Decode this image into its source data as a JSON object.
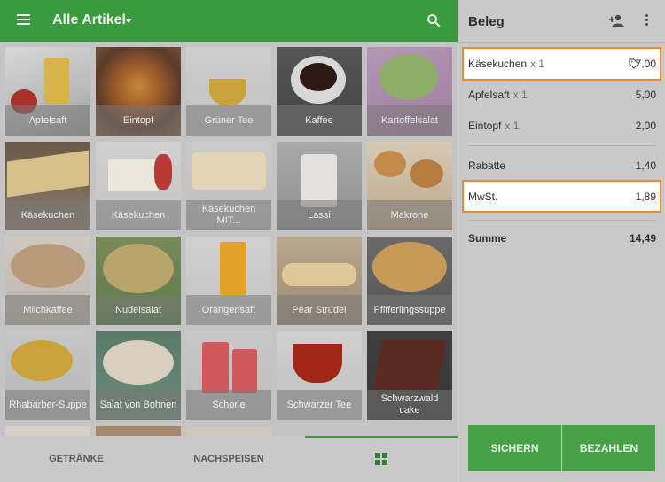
{
  "header": {
    "title": "Alle Artikel",
    "menu_icon": "menu-icon",
    "search_icon": "search-icon"
  },
  "products": [
    {
      "label": "Apfelsaft"
    },
    {
      "label": "Eintopf"
    },
    {
      "label": "Grüner Tee"
    },
    {
      "label": "Kaffee"
    },
    {
      "label": "Kartoffelsalat"
    },
    {
      "label": "Käsekuchen"
    },
    {
      "label": "Käsekuchen"
    },
    {
      "label": "Käsekuchen MIT..."
    },
    {
      "label": "Lassi"
    },
    {
      "label": "Makrone"
    },
    {
      "label": "Milchkaffee"
    },
    {
      "label": "Nudelsalat"
    },
    {
      "label": "Orangensaft"
    },
    {
      "label": "Pear Strudel"
    },
    {
      "label": "Pfifferlingssuppe"
    },
    {
      "label": "Rhabarber-Suppe"
    },
    {
      "label": "Salat von Bohnen"
    },
    {
      "label": "Schorle"
    },
    {
      "label": "Schwarzer Tee"
    },
    {
      "label": "Schwarzwald cake"
    }
  ],
  "bottom_tabs": [
    {
      "label": "GETRÄNKE"
    },
    {
      "label": "NACHSPEISEN"
    }
  ],
  "receipt": {
    "title": "Beleg",
    "items": [
      {
        "name": "Käsekuchen",
        "qty": "x 1",
        "amount": "7,00"
      },
      {
        "name": "Apfelsaft",
        "qty": "x 1",
        "amount": "5,00"
      },
      {
        "name": "Eintopf",
        "qty": "x 1",
        "amount": "2,00"
      }
    ],
    "discount": {
      "label": "Rabatte",
      "amount": "1,40"
    },
    "tax": {
      "label": "MwSt.",
      "amount": "1,89"
    },
    "total": {
      "label": "Summe",
      "amount": "14,49"
    },
    "save_label": "SICHERN",
    "pay_label": "BEZAHLEN"
  },
  "colors": {
    "accent": "#3b9a3f",
    "highlight_border": "#ef8a2c"
  }
}
